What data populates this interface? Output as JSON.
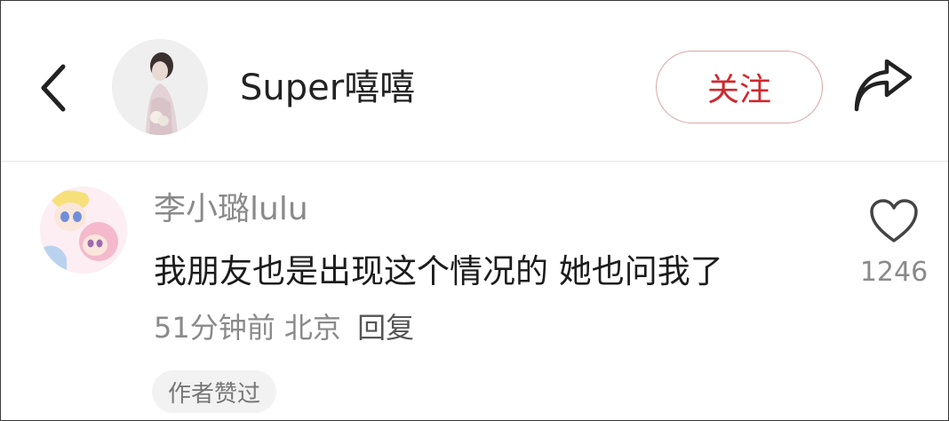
{
  "header": {
    "username": "Super嘻嘻",
    "follow_label": "关注",
    "icons": [
      "back-chevron-icon",
      "share-arrow-icon"
    ]
  },
  "comment": {
    "author": "李小璐lulu",
    "text": "我朋友也是出现这个情况的 她也问我了",
    "time": "51分钟前",
    "location": "北京",
    "reply_label": "回复",
    "likes": "1246",
    "author_liked_badge": "作者赞过"
  },
  "colors": {
    "follow_red": "#d0282e",
    "muted_text": "#8a8a8a",
    "badge_bg": "#f2f2f2"
  }
}
